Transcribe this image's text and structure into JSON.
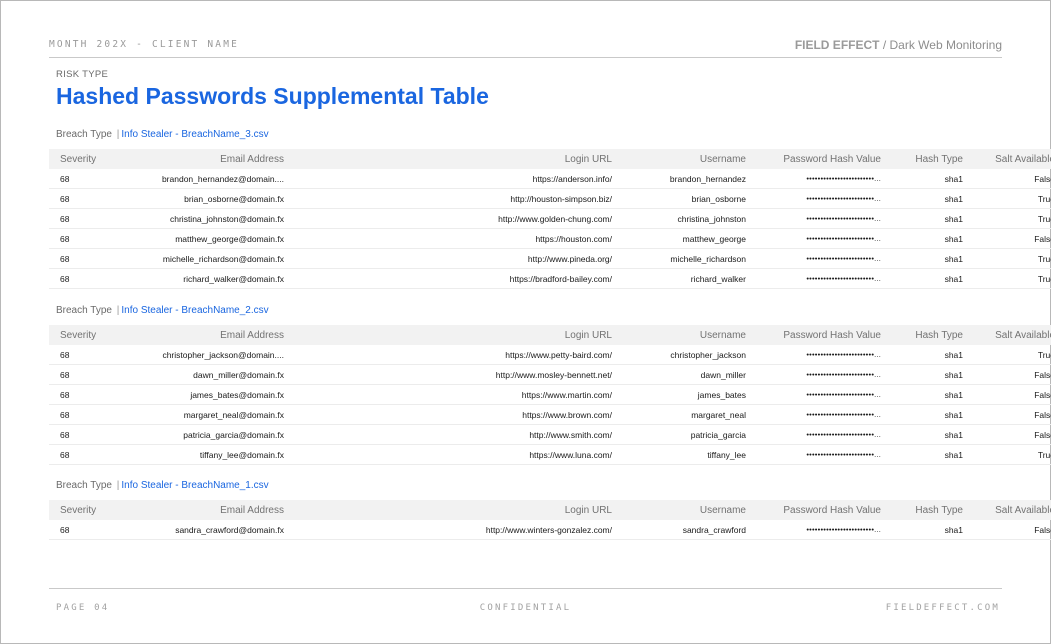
{
  "header": {
    "left": "MONTH 202X - CLIENT NAME",
    "brand": "FIELD EFFECT",
    "separator": " / ",
    "section": "Dark Web Monitoring"
  },
  "risk_type_label": "RISK TYPE",
  "title": "Hashed Passwords Supplemental Table",
  "columns": [
    "Severity",
    "Email Address",
    "Login URL",
    "Username",
    "Password Hash Value",
    "Hash Type",
    "Salt Available"
  ],
  "breaches": [
    {
      "label": "Breach Type",
      "separator": "|",
      "file": "Info Stealer - BreachName_3.csv",
      "rows": [
        [
          "68",
          "brandon_hernandez@domain....",
          "https://anderson.info/",
          "brandon_hernandez",
          "••••••••••••••••••••••••...",
          "sha1",
          "False"
        ],
        [
          "68",
          "brian_osborne@domain.fx",
          "http://houston-simpson.biz/",
          "brian_osborne",
          "••••••••••••••••••••••••...",
          "sha1",
          "True"
        ],
        [
          "68",
          "christina_johnston@domain.fx",
          "http://www.golden-chung.com/",
          "christina_johnston",
          "••••••••••••••••••••••••...",
          "sha1",
          "True"
        ],
        [
          "68",
          "matthew_george@domain.fx",
          "https://houston.com/",
          "matthew_george",
          "••••••••••••••••••••••••...",
          "sha1",
          "False"
        ],
        [
          "68",
          "michelle_richardson@domain.fx",
          "http://www.pineda.org/",
          "michelle_richardson",
          "••••••••••••••••••••••••...",
          "sha1",
          "True"
        ],
        [
          "68",
          "richard_walker@domain.fx",
          "https://bradford-bailey.com/",
          "richard_walker",
          "••••••••••••••••••••••••...",
          "sha1",
          "True"
        ]
      ]
    },
    {
      "label": "Breach Type",
      "separator": "|",
      "file": "Info Stealer - BreachName_2.csv",
      "rows": [
        [
          "68",
          "christopher_jackson@domain....",
          "https://www.petty-baird.com/",
          "christopher_jackson",
          "••••••••••••••••••••••••...",
          "sha1",
          "True"
        ],
        [
          "68",
          "dawn_miller@domain.fx",
          "http://www.mosley-bennett.net/",
          "dawn_miller",
          "••••••••••••••••••••••••...",
          "sha1",
          "False"
        ],
        [
          "68",
          "james_bates@domain.fx",
          "https://www.martin.com/",
          "james_bates",
          "••••••••••••••••••••••••...",
          "sha1",
          "False"
        ],
        [
          "68",
          "margaret_neal@domain.fx",
          "https://www.brown.com/",
          "margaret_neal",
          "••••••••••••••••••••••••...",
          "sha1",
          "False"
        ],
        [
          "68",
          "patricia_garcia@domain.fx",
          "http://www.smith.com/",
          "patricia_garcia",
          "••••••••••••••••••••••••...",
          "sha1",
          "False"
        ],
        [
          "68",
          "tiffany_lee@domain.fx",
          "https://www.luna.com/",
          "tiffany_lee",
          "••••••••••••••••••••••••...",
          "sha1",
          "True"
        ]
      ]
    },
    {
      "label": "Breach Type",
      "separator": "|",
      "file": "Info Stealer - BreachName_1.csv",
      "rows": [
        [
          "68",
          "sandra_crawford@domain.fx",
          "http://www.winters-gonzalez.com/",
          "sandra_crawford",
          "••••••••••••••••••••••••...",
          "sha1",
          "False"
        ]
      ]
    }
  ],
  "footer": {
    "page": "PAGE 04",
    "center": "CONFIDENTIAL",
    "right": "FIELDEFFECT.COM"
  },
  "colors": {
    "accent": "#1a66e0",
    "header_bg": "#f2f2f2",
    "muted": "#9a9a9a"
  }
}
